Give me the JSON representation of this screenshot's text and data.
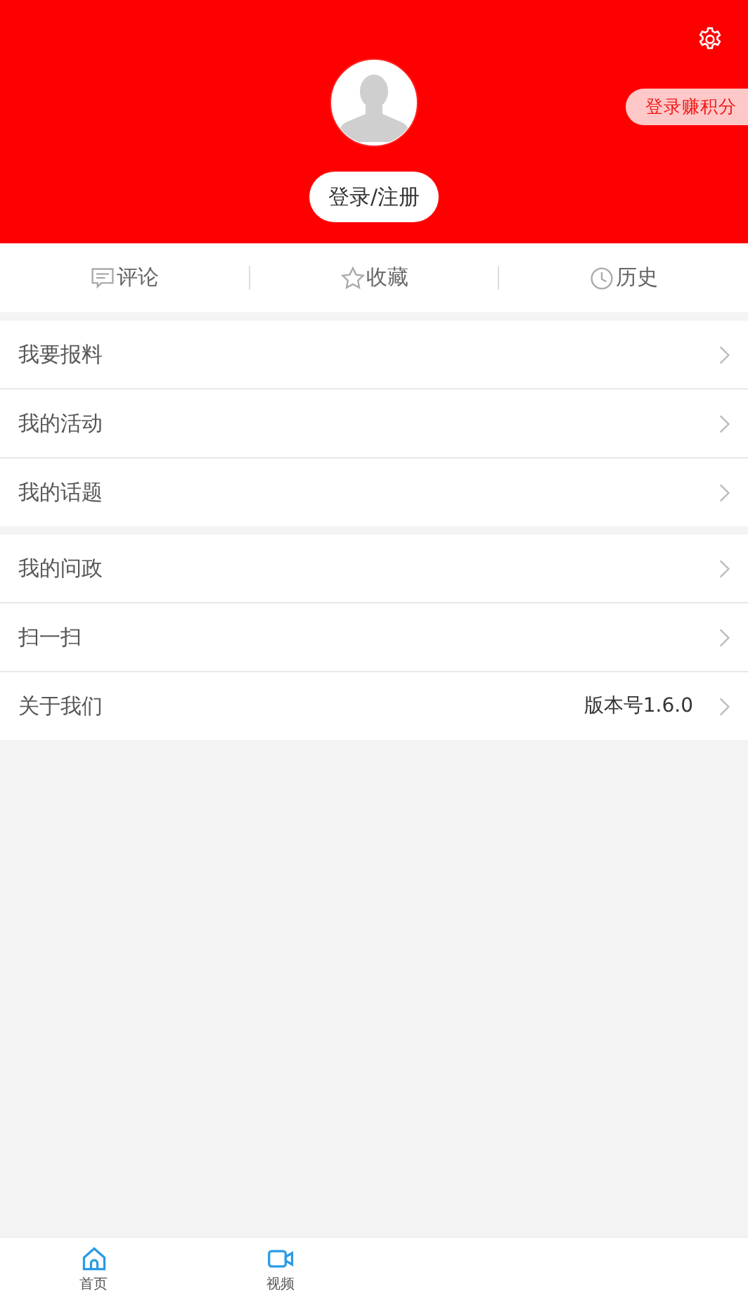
{
  "header": {
    "login_button": "登录/注册",
    "points_badge": "登录赚积分"
  },
  "shortcuts": [
    {
      "kind": "comment",
      "label": "评论"
    },
    {
      "kind": "star",
      "label": "收藏"
    },
    {
      "kind": "clock",
      "label": "历史"
    }
  ],
  "menu_groups": [
    {
      "items": [
        {
          "label": "我要报料"
        },
        {
          "label": "我的活动"
        },
        {
          "label": "我的话题"
        }
      ]
    },
    {
      "items": [
        {
          "label": "我的问政"
        },
        {
          "label": "扫一扫"
        },
        {
          "label": "关于我们",
          "value": "版本号1.6.0"
        }
      ]
    }
  ],
  "bottom_nav": [
    {
      "kind": "home",
      "label": "首页"
    },
    {
      "kind": "video",
      "label": "视频"
    }
  ]
}
